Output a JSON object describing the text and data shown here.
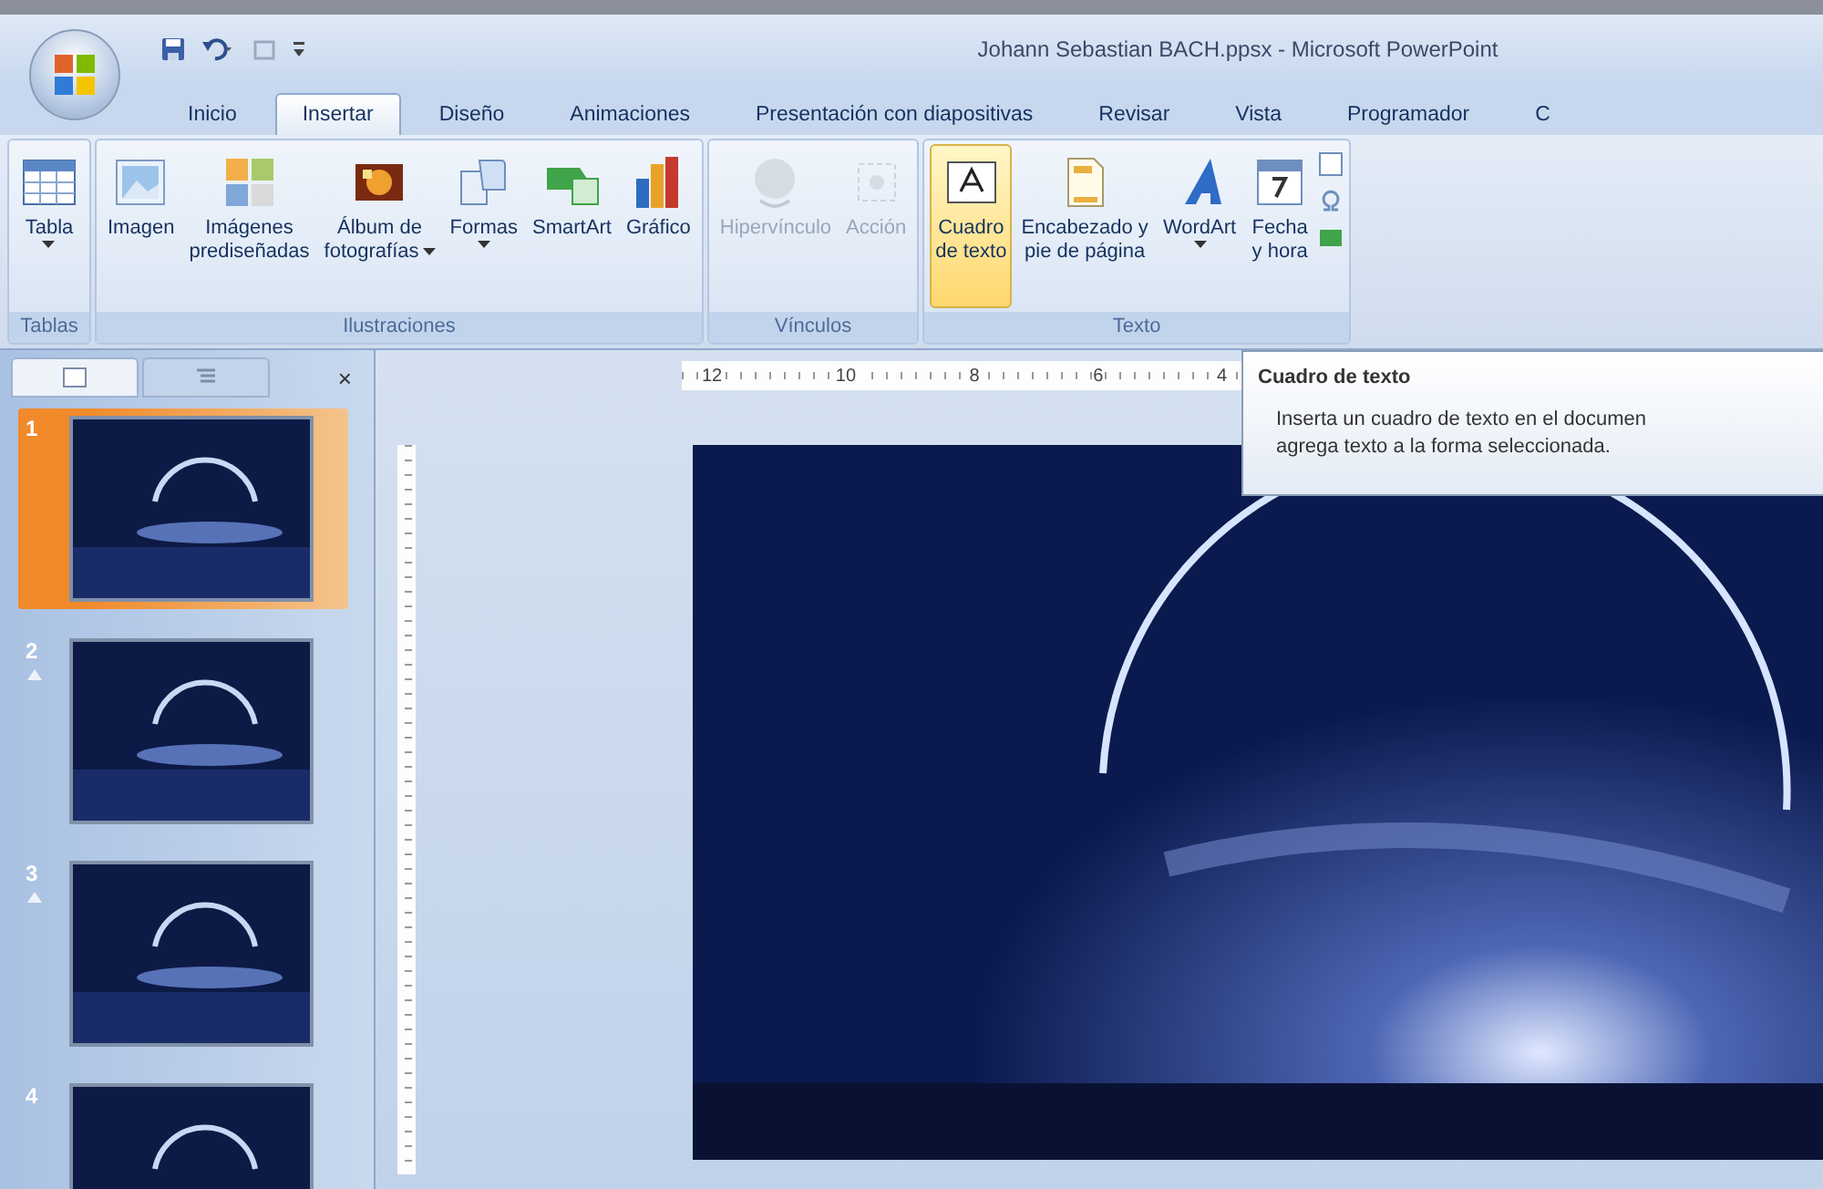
{
  "window": {
    "title": "Johann Sebastian BACH.ppsx - Microsoft PowerPoint"
  },
  "tabs": [
    {
      "label": "Inicio",
      "selected": false
    },
    {
      "label": "Insertar",
      "selected": true
    },
    {
      "label": "Diseño",
      "selected": false
    },
    {
      "label": "Animaciones",
      "selected": false
    },
    {
      "label": "Presentación con diapositivas",
      "selected": false
    },
    {
      "label": "Revisar",
      "selected": false
    },
    {
      "label": "Vista",
      "selected": false
    },
    {
      "label": "Programador",
      "selected": false
    },
    {
      "label": "C",
      "selected": false
    }
  ],
  "ribbon_groups": [
    {
      "label": "Tablas",
      "buttons": [
        {
          "lines": [
            "Tabla"
          ],
          "dropdown": true,
          "disabled": false,
          "hovered": false
        }
      ]
    },
    {
      "label": "Ilustraciones",
      "buttons": [
        {
          "lines": [
            "Imagen"
          ],
          "dropdown": false,
          "disabled": false,
          "hovered": false
        },
        {
          "lines": [
            "Imágenes",
            "prediseñadas"
          ],
          "dropdown": false,
          "disabled": false,
          "hovered": false
        },
        {
          "lines": [
            "Álbum de",
            "fotografías"
          ],
          "dropdown": true,
          "disabled": false,
          "hovered": false
        },
        {
          "lines": [
            "Formas"
          ],
          "dropdown": true,
          "disabled": false,
          "hovered": false
        },
        {
          "lines": [
            "SmartArt"
          ],
          "dropdown": false,
          "disabled": false,
          "hovered": false
        },
        {
          "lines": [
            "Gráfico"
          ],
          "dropdown": false,
          "disabled": false,
          "hovered": false
        }
      ]
    },
    {
      "label": "Vínculos",
      "buttons": [
        {
          "lines": [
            "Hipervínculo"
          ],
          "dropdown": false,
          "disabled": true,
          "hovered": false
        },
        {
          "lines": [
            "Acción"
          ],
          "dropdown": false,
          "disabled": true,
          "hovered": false
        }
      ]
    },
    {
      "label": "Texto",
      "buttons": [
        {
          "lines": [
            "Cuadro",
            "de texto"
          ],
          "dropdown": false,
          "disabled": false,
          "hovered": true
        },
        {
          "lines": [
            "Encabezado y",
            "pie de página"
          ],
          "dropdown": false,
          "disabled": false,
          "hovered": false
        },
        {
          "lines": [
            "WordArt"
          ],
          "dropdown": true,
          "disabled": false,
          "hovered": false
        },
        {
          "lines": [
            "Fecha",
            "y hora"
          ],
          "dropdown": false,
          "disabled": false,
          "hovered": false
        }
      ]
    }
  ],
  "slide_panel": {
    "tabs": [
      {
        "kind": "slides",
        "selected": true
      },
      {
        "kind": "outline",
        "selected": false
      }
    ],
    "close": "×",
    "slides": [
      {
        "number": "1",
        "selected": true,
        "animated": false
      },
      {
        "number": "2",
        "selected": false,
        "animated": true
      },
      {
        "number": "3",
        "selected": false,
        "animated": true
      },
      {
        "number": "4",
        "selected": false,
        "animated": false
      }
    ]
  },
  "ruler": {
    "labels": [
      "12",
      "10",
      "8",
      "6",
      "4"
    ]
  },
  "tooltip": {
    "title": "Cuadro de texto",
    "body": [
      "Inserta un cuadro de texto en el documen",
      "agrega texto a la forma seleccionada."
    ]
  }
}
